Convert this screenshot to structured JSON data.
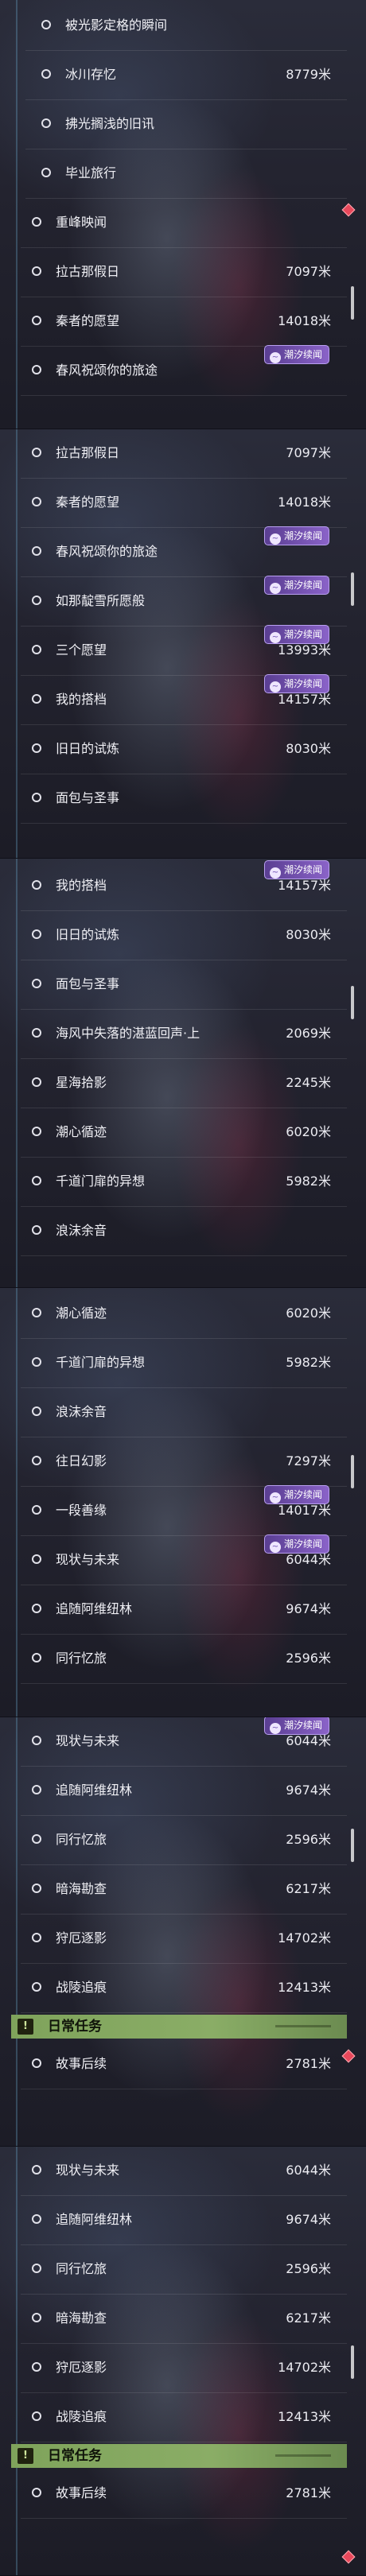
{
  "colors": {
    "ring": "#e2e2ea",
    "badge": "#7a56bd",
    "category_header": "#86aa62",
    "alert": "#e8485b"
  },
  "icons": {
    "quest_status": "ring-icon",
    "tide_badge": "tide-icon",
    "alert": "diamond-icon",
    "category": "quest-icon"
  },
  "panels": [
    {
      "rows": [
        {
          "label": "被光影定格的瞬间",
          "dist": "",
          "badge": "",
          "indent": true
        },
        {
          "label": "冰川存忆",
          "dist": "8779米",
          "badge": "",
          "indent": true
        },
        {
          "label": "拂光搁浅的旧讯",
          "dist": "",
          "badge": "",
          "indent": true
        },
        {
          "label": "毕业旅行",
          "dist": "",
          "badge": "",
          "indent": true
        },
        {
          "label": "重峰映闻",
          "dist": "",
          "badge": "",
          "indent": false
        },
        {
          "label": "拉古那假日",
          "dist": "7097米",
          "badge": "",
          "indent": false
        },
        {
          "label": "秦者的愿望",
          "dist": "14018米",
          "badge": "",
          "indent": false
        },
        {
          "label": "春风祝颂你的旅途",
          "dist": "",
          "badge": "潮汐续闻",
          "indent": false
        }
      ]
    },
    {
      "rows": [
        {
          "label": "拉古那假日",
          "dist": "7097米",
          "badge": "",
          "indent": false
        },
        {
          "label": "秦者的愿望",
          "dist": "14018米",
          "badge": "",
          "indent": false
        },
        {
          "label": "春风祝颂你的旅途",
          "dist": "",
          "badge": "潮汐续闻",
          "indent": false
        },
        {
          "label": "如那靛雪所愿般",
          "dist": "",
          "badge": "潮汐续闻",
          "indent": false
        },
        {
          "label": "三个愿望",
          "dist": "13993米",
          "badge": "潮汐续闻",
          "indent": false
        },
        {
          "label": "我的搭档",
          "dist": "14157米",
          "badge": "潮汐续闻",
          "indent": false
        },
        {
          "label": "旧日的试炼",
          "dist": "8030米",
          "badge": "",
          "indent": false
        },
        {
          "label": "面包与圣事",
          "dist": "",
          "badge": "",
          "indent": false
        }
      ]
    },
    {
      "rows": [
        {
          "label": "我的搭档",
          "dist": "14157米",
          "badge": "潮汐续闻",
          "indent": false
        },
        {
          "label": "旧日的试炼",
          "dist": "8030米",
          "badge": "",
          "indent": false
        },
        {
          "label": "面包与圣事",
          "dist": "",
          "badge": "",
          "indent": false
        },
        {
          "label": "海风中失落的湛蓝回声·上",
          "dist": "2069米",
          "badge": "",
          "indent": false
        },
        {
          "label": "星海拾影",
          "dist": "2245米",
          "badge": "",
          "indent": false
        },
        {
          "label": "潮心循迹",
          "dist": "6020米",
          "badge": "",
          "indent": false
        },
        {
          "label": "千道门扉的异想",
          "dist": "5982米",
          "badge": "",
          "indent": false
        },
        {
          "label": "浪沫余音",
          "dist": "",
          "badge": "",
          "indent": false
        }
      ]
    },
    {
      "rows": [
        {
          "label": "潮心循迹",
          "dist": "6020米",
          "badge": "",
          "indent": false
        },
        {
          "label": "千道门扉的异想",
          "dist": "5982米",
          "badge": "",
          "indent": false
        },
        {
          "label": "浪沫余音",
          "dist": "",
          "badge": "",
          "indent": false
        },
        {
          "label": "往日幻影",
          "dist": "7297米",
          "badge": "",
          "indent": false
        },
        {
          "label": "一段善缘",
          "dist": "14017米",
          "badge": "潮汐续闻",
          "indent": false
        },
        {
          "label": "现状与未来",
          "dist": "6044米",
          "badge": "潮汐续闻",
          "indent": false
        },
        {
          "label": "追随阿维纽林",
          "dist": "9674米",
          "badge": "",
          "indent": false
        },
        {
          "label": "同行忆旅",
          "dist": "2596米",
          "badge": "",
          "indent": false
        }
      ]
    },
    {
      "rows": [
        {
          "label": "现状与未来",
          "dist": "6044米",
          "badge": "潮汐续闻",
          "indent": false
        },
        {
          "label": "追随阿维纽林",
          "dist": "9674米",
          "badge": "",
          "indent": false
        },
        {
          "label": "同行忆旅",
          "dist": "2596米",
          "badge": "",
          "indent": false
        },
        {
          "label": "暗海勘查",
          "dist": "6217米",
          "badge": "",
          "indent": false
        },
        {
          "label": "狩厄逐影",
          "dist": "14702米",
          "badge": "",
          "indent": false
        },
        {
          "label": "战陵追痕",
          "dist": "12413米",
          "badge": "",
          "indent": false
        }
      ],
      "category": "日常任务",
      "after": {
        "label": "故事后续",
        "dist": "2781米",
        "badge": "",
        "indent": false
      }
    },
    {
      "rows": [
        {
          "label": "现状与未来",
          "dist": "6044米",
          "badge": "",
          "indent": false
        },
        {
          "label": "追随阿维纽林",
          "dist": "9674米",
          "badge": "",
          "indent": false
        },
        {
          "label": "同行忆旅",
          "dist": "2596米",
          "badge": "",
          "indent": false
        },
        {
          "label": "暗海勘查",
          "dist": "6217米",
          "badge": "",
          "indent": false
        },
        {
          "label": "狩厄逐影",
          "dist": "14702米",
          "badge": "",
          "indent": false
        },
        {
          "label": "战陵追痕",
          "dist": "12413米",
          "badge": "",
          "indent": false
        }
      ],
      "category": "日常任务",
      "after": {
        "label": "故事后续",
        "dist": "2781米",
        "badge": "",
        "indent": false
      }
    }
  ]
}
